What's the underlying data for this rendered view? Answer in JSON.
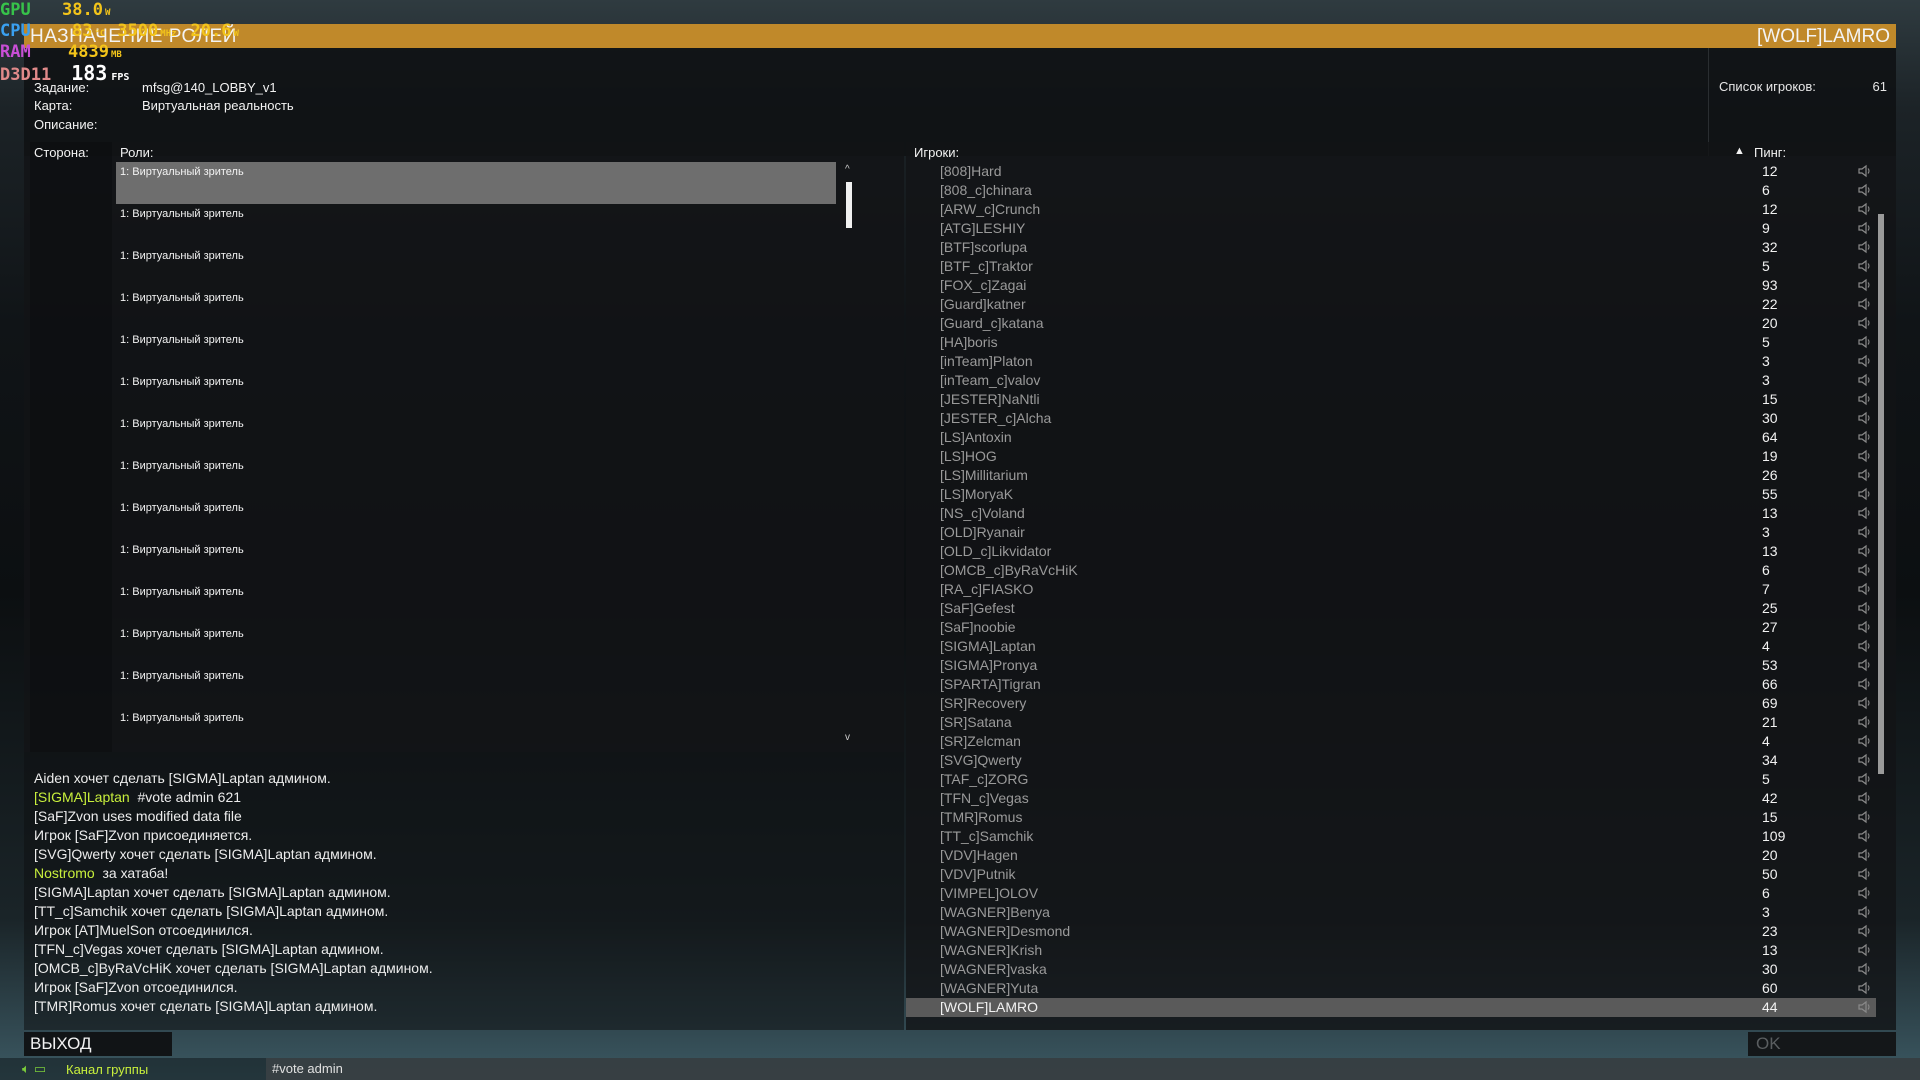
{
  "overlay": {
    "gpu_label": "GPU",
    "gpu_value": "38.0",
    "gpu_unit": "W",
    "cpu_label": "CPU",
    "cpu_temp": "83",
    "cpu_temp_unit": "°C",
    "cpu_freq": "3500",
    "cpu_freq_unit": "MHz",
    "cpu_power": "20.6",
    "cpu_power_unit": "W",
    "ram_label": "RAM",
    "ram_value": "4839",
    "ram_unit": "MB",
    "d3d_label": "D3D11",
    "fps_value": "183",
    "fps_unit": "FPS"
  },
  "window": {
    "title": "НАЗНАЧЕНИЕ РОЛЕЙ",
    "user": "[WOLF]LAMRO"
  },
  "info": {
    "mission_label": "Задание:",
    "mission_value": "mfsg@140_LOBBY_v1",
    "map_label": "Карта:",
    "map_value": "Виртуальная реальность",
    "desc_label": "Описание:",
    "player_list_label": "Список игроков:",
    "player_count": "61"
  },
  "roles_panel": {
    "side_header": "Сторона:",
    "roles_header": "Роли:",
    "roles": [
      "1: Виртуальный зритель",
      "1: Виртуальный зритель",
      "1: Виртуальный зритель",
      "1: Виртуальный зритель",
      "1: Виртуальный зритель",
      "1: Виртуальный зритель",
      "1: Виртуальный зритель",
      "1: Виртуальный зритель",
      "1: Виртуальный зритель",
      "1: Виртуальный зритель",
      "1: Виртуальный зритель",
      "1: Виртуальный зритель",
      "1: Виртуальный зритель",
      "1: Виртуальный зритель"
    ],
    "scroll_up": "^",
    "scroll_down": "v"
  },
  "players_panel": {
    "players_header": "Игроки:",
    "sort_icon": "sort-up-icon",
    "ping_header": "Пинг:",
    "players": [
      {
        "name": "[808]Hard",
        "ping": "12"
      },
      {
        "name": "[808_c]chinara",
        "ping": "6"
      },
      {
        "name": "[ARW_c]Crunch",
        "ping": "12"
      },
      {
        "name": "[ATG]LESHIY",
        "ping": "9"
      },
      {
        "name": "[BTF]scorlupa",
        "ping": "32"
      },
      {
        "name": "[BTF_c]Traktor",
        "ping": "5"
      },
      {
        "name": "[FOX_c]Zagai",
        "ping": "93"
      },
      {
        "name": "[Guard]katner",
        "ping": "22"
      },
      {
        "name": "[Guard_c]katana",
        "ping": "20"
      },
      {
        "name": "[HA]boris",
        "ping": "5"
      },
      {
        "name": "[inTeam]Platon",
        "ping": "3"
      },
      {
        "name": "[inTeam_c]valov",
        "ping": "3"
      },
      {
        "name": "[JESTER]NaNtli",
        "ping": "15"
      },
      {
        "name": "[JESTER_c]Alcha",
        "ping": "30"
      },
      {
        "name": "[LS]Antoxin",
        "ping": "64"
      },
      {
        "name": "[LS]HOG",
        "ping": "19"
      },
      {
        "name": "[LS]Millitarium",
        "ping": "26"
      },
      {
        "name": "[LS]MoryaK",
        "ping": "55"
      },
      {
        "name": "[NS_c]Voland",
        "ping": "13"
      },
      {
        "name": "[OLD]Ryanair",
        "ping": "3"
      },
      {
        "name": "[OLD_c]Likvidator",
        "ping": "13"
      },
      {
        "name": "[OMCB_c]ByRaVcHiK",
        "ping": "6"
      },
      {
        "name": "[RA_c]FIASKO",
        "ping": "7"
      },
      {
        "name": "[SaF]Gefest",
        "ping": "25"
      },
      {
        "name": "[SaF]noobie",
        "ping": "27"
      },
      {
        "name": "[SIGMA]Laptan",
        "ping": "4"
      },
      {
        "name": "[SIGMA]Pronya",
        "ping": "53"
      },
      {
        "name": "[SPARTA]Tigran",
        "ping": "66"
      },
      {
        "name": "[SR]Recovery",
        "ping": "69"
      },
      {
        "name": "[SR]Satana",
        "ping": "21"
      },
      {
        "name": "[SR]Zelcman",
        "ping": "4"
      },
      {
        "name": "[SVG]Qwerty",
        "ping": "34"
      },
      {
        "name": "[TAF_c]ZORG",
        "ping": "5"
      },
      {
        "name": "[TFN_c]Vegas",
        "ping": "42"
      },
      {
        "name": "[TMR]Romus",
        "ping": "15"
      },
      {
        "name": "[TT_c]Samchik",
        "ping": "109"
      },
      {
        "name": "[VDV]Hagen",
        "ping": "20"
      },
      {
        "name": "[VDV]Putnik",
        "ping": "50"
      },
      {
        "name": "[VIMPEL]OLOV",
        "ping": "6"
      },
      {
        "name": "[WAGNER]Benya",
        "ping": "3"
      },
      {
        "name": "[WAGNER]Desmond",
        "ping": "23"
      },
      {
        "name": "[WAGNER]Krish",
        "ping": "13"
      },
      {
        "name": "[WAGNER]vaska",
        "ping": "30"
      },
      {
        "name": "[WAGNER]Yuta",
        "ping": "60"
      },
      {
        "name": "[WOLF]LAMRO",
        "ping": "44",
        "selected": true
      }
    ]
  },
  "chat": {
    "messages": [
      {
        "text": "Aiden хочет сделать [SIGMA]Laptan админом."
      },
      {
        "sender": "[SIGMA]Laptan",
        "text": "#vote admin 621"
      },
      {
        "text": "[SaF]Zvon uses modified data file"
      },
      {
        "text": "Игрок [SaF]Zvon присоединяется."
      },
      {
        "text": "[SVG]Qwerty хочет сделать [SIGMA]Laptan админом."
      },
      {
        "sender": "Nostromo",
        "text": "за хатаба!"
      },
      {
        "text": "[SIGMA]Laptan хочет сделать [SIGMA]Laptan админом."
      },
      {
        "text": "[TT_c]Samchik хочет сделать [SIGMA]Laptan админом."
      },
      {
        "text": "Игрок [AT]MuelSon отсоединился."
      },
      {
        "text": "[TFN_c]Vegas хочет сделать [SIGMA]Laptan админом."
      },
      {
        "text": "[OMCB_c]ByRaVcHiK хочет сделать [SIGMA]Laptan админом."
      },
      {
        "text": "Игрок [SaF]Zvon отсоединился."
      },
      {
        "text": "[TMR]Romus хочет сделать [SIGMA]Laptan админом."
      }
    ]
  },
  "buttons": {
    "exit": "ВЫХОД",
    "ok": "OK"
  },
  "channel": {
    "name": "Канал группы",
    "input_value": "#vote admin"
  },
  "colors": {
    "title_bar": "#c0892a",
    "highlight_name": "#c8ef3c"
  }
}
